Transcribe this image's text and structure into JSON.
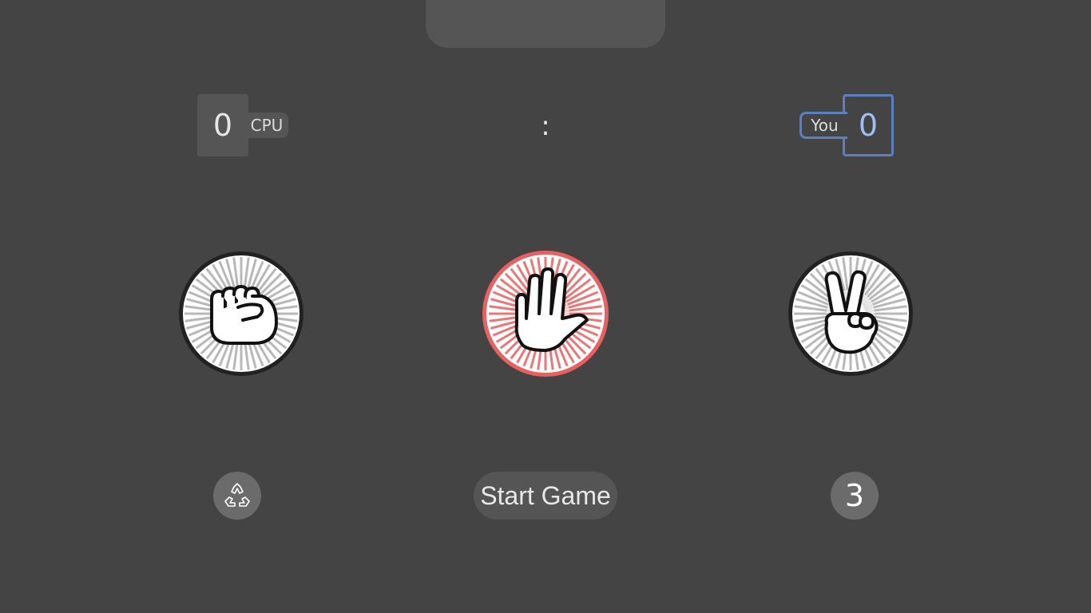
{
  "scoreboard": {
    "cpu_score": "0",
    "cpu_label": "CPU",
    "separator": ":",
    "you_label": "You",
    "you_score": "0"
  },
  "choices": [
    {
      "name": "rock",
      "icon": "fist-icon",
      "selected": false
    },
    {
      "name": "paper",
      "icon": "open-hand-icon",
      "selected": true
    },
    {
      "name": "scissors",
      "icon": "peace-sign-icon",
      "selected": false
    }
  ],
  "controls": {
    "reset_icon": "recycle-icon",
    "start_label": "Start Game",
    "rounds": "3"
  },
  "colors": {
    "background": "#444444",
    "selected_accent": "#e86060",
    "player_accent": "#5b80c2",
    "default_ring": "#222222"
  }
}
